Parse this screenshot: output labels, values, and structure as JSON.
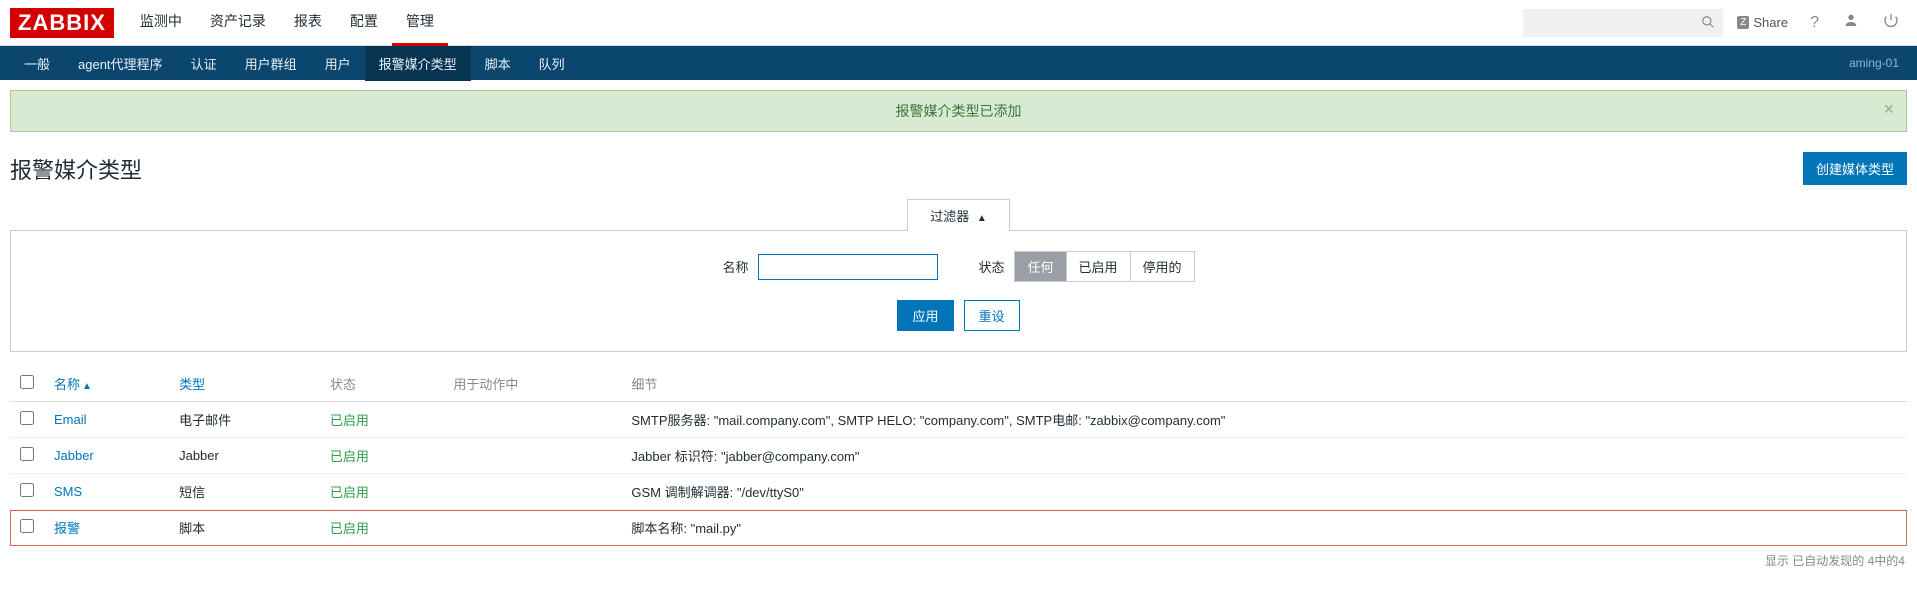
{
  "brand": "ZABBIX",
  "topnav": {
    "items": [
      "监测中",
      "资产记录",
      "报表",
      "配置",
      "管理"
    ],
    "active": 4,
    "share": "Share",
    "search_placeholder": ""
  },
  "subnav": {
    "items": [
      "一般",
      "agent代理程序",
      "认证",
      "用户群组",
      "用户",
      "报警媒介类型",
      "脚本",
      "队列"
    ],
    "active": 5,
    "host": "aming-01"
  },
  "message": {
    "text": "报警媒介类型已添加"
  },
  "page": {
    "title": "报警媒介类型",
    "create_btn": "创建媒体类型"
  },
  "filter": {
    "tab_label": "过滤器",
    "name_label": "名称",
    "name_value": "",
    "status_label": "状态",
    "status_options": [
      "任何",
      "已启用",
      "停用的"
    ],
    "status_active": 0,
    "apply": "应用",
    "reset": "重设"
  },
  "table": {
    "headers": {
      "name": "名称",
      "type": "类型",
      "status": "状态",
      "used_in": "用于动作中",
      "details": "细节"
    },
    "rows": [
      {
        "name": "Email",
        "type": "电子邮件",
        "status": "已启用",
        "used_in": "",
        "details": "SMTP服务器: \"mail.company.com\", SMTP HELO: \"company.com\", SMTP电邮: \"zabbix@company.com\"",
        "highlight": false
      },
      {
        "name": "Jabber",
        "type": "Jabber",
        "status": "已启用",
        "used_in": "",
        "details": "Jabber 标识符: \"jabber@company.com\"",
        "highlight": false
      },
      {
        "name": "SMS",
        "type": "短信",
        "status": "已启用",
        "used_in": "",
        "details": "GSM 调制解调器: \"/dev/ttyS0\"",
        "highlight": false
      },
      {
        "name": "报警",
        "type": "脚本",
        "status": "已启用",
        "used_in": "",
        "details": "脚本名称: \"mail.py\"",
        "highlight": true
      }
    ]
  },
  "footer": "显示 已自动发现的 4中的4"
}
